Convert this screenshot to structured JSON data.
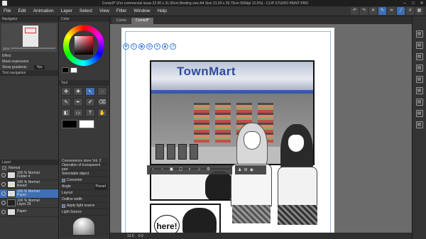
{
  "window": {
    "title": "Comic8* (For commercial issue 22.00 x 31.00cm Binding size:A4 Size 21.00 x 29.70cm 600dpi 12.5%) - CLIP STUDIO PAINT PRO",
    "min": "–",
    "max": "□",
    "close": "✕"
  },
  "menu": [
    "File",
    "Edit",
    "Animation",
    "Layer",
    "Select",
    "View",
    "Filter",
    "Window",
    "Help"
  ],
  "left": {
    "navigator_title": "Navigator",
    "zoom": "12.5",
    "effect_label": "Effect",
    "mask_label": "Mask expression",
    "show_gradients": "Show gradients",
    "show_gradients_value": "Yes",
    "tool_nav_label": "Tool navigation",
    "layer_header": "Layer",
    "blend_mode": "Normal",
    "layers": [
      {
        "name": "100 % Normal\nFolder 4",
        "dark": false,
        "sel": false
      },
      {
        "name": "100 % Normal\nlineart",
        "dark": false,
        "sel": false
      },
      {
        "name": "100 % Normal\nPaper",
        "dark": false,
        "sel": true
      },
      {
        "name": "100 % Normal\nLayer 29",
        "dark": true,
        "sel": false
      },
      {
        "name": "Paper",
        "dark": false,
        "sel": false
      }
    ]
  },
  "mid": {
    "color_title": "Color",
    "tool_title": "Tool",
    "tool_prop_title": "Tool propert",
    "sub_tool": "Convenience store Vol. 2",
    "prop_rows": [
      "Operation of transparent part",
      "Selectable object",
      "Converter",
      "Angle",
      "Layout",
      "Outline width",
      "Apply light source",
      "Light Source"
    ],
    "preset": "Preset",
    "tools": [
      "✥",
      "✚",
      "↖",
      "◌",
      "✎",
      "✒",
      "✐",
      "⌫",
      "◧",
      "▭",
      "T",
      "✋"
    ]
  },
  "canvas": {
    "tabs": [
      "Comic",
      "Comic8*"
    ],
    "store_sign": "TownMart",
    "speech_text": "here!",
    "status_zoom": "12.5",
    "status_pos": "0.0"
  },
  "colors": {
    "accent": "#3f6fb5",
    "sign_blue": "#2f4b9e",
    "main_color": "#000000",
    "sub_color": "#ffffff"
  }
}
